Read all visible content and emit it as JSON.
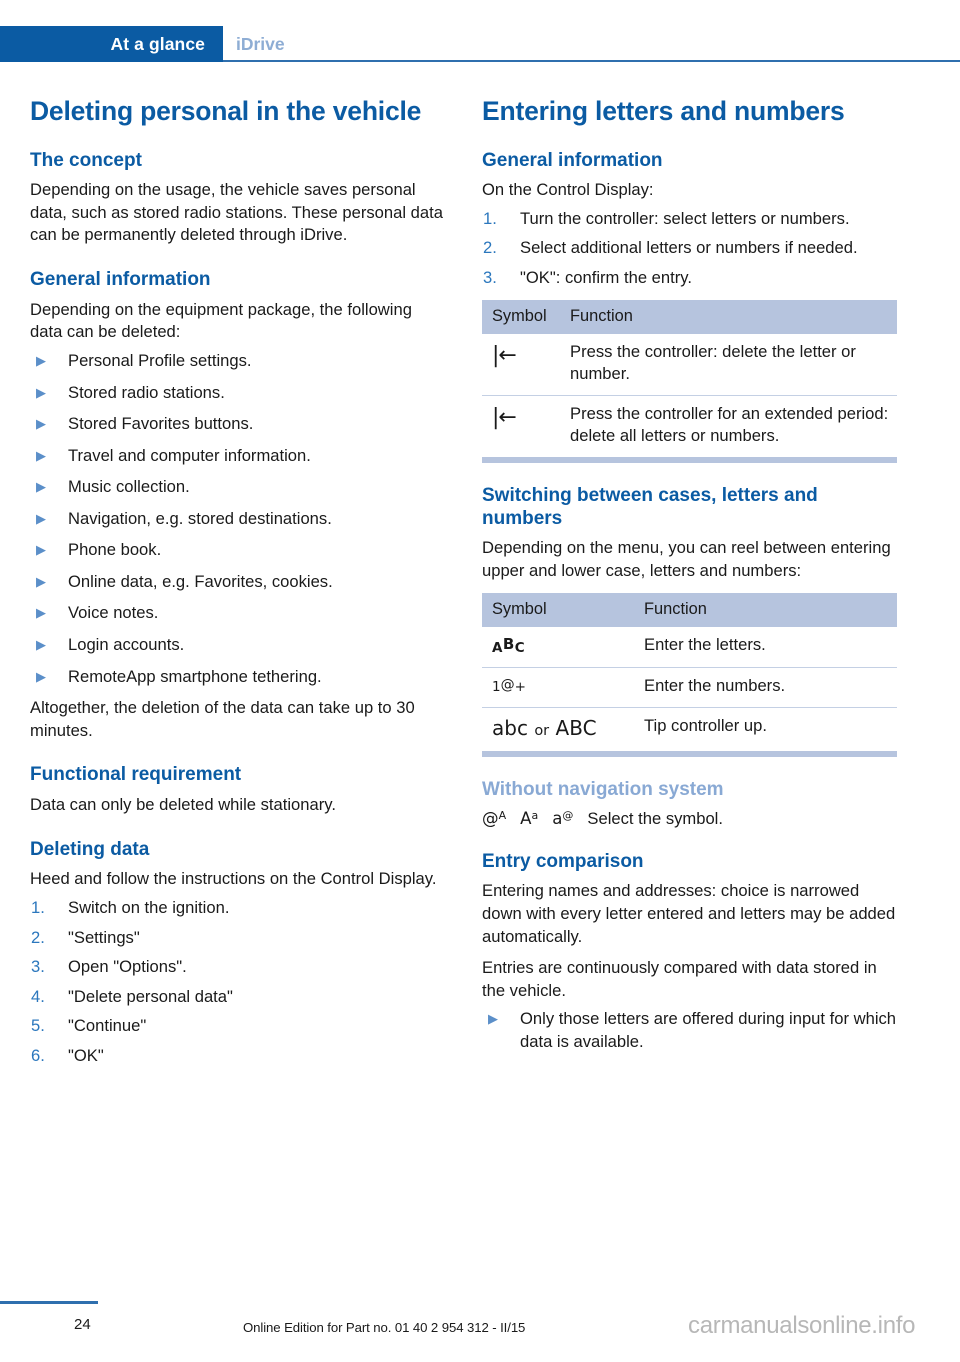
{
  "header": {
    "tab_active": "At a glance",
    "tab_inactive": "iDrive",
    "accent_color": "#0b5ba3",
    "inactive_color": "#8eadd4"
  },
  "left_column": {
    "title": "Deleting personal in the vehicle",
    "sections": [
      {
        "heading": "The concept",
        "paragraphs": [
          "Depending on the usage, the vehicle saves personal data, such as stored radio stations. These personal data can be permanently deleted through iDrive."
        ]
      },
      {
        "heading": "General information",
        "intro": "Depending on the equipment package, the following data can be deleted:",
        "bullets": [
          "Personal Profile settings.",
          "Stored radio stations.",
          "Stored Favorites buttons.",
          "Travel and computer information.",
          "Music collection.",
          "Navigation, e.g. stored destinations.",
          "Phone book.",
          "Online data, e.g. Favorites, cookies.",
          "Voice notes.",
          "Login accounts.",
          "RemoteApp smartphone tethering."
        ],
        "outro": "Altogether, the deletion of the data can take up to 30 minutes."
      },
      {
        "heading": "Functional requirement",
        "paragraphs": [
          "Data can only be deleted while stationary."
        ]
      },
      {
        "heading": "Deleting data",
        "intro": "Heed and follow the instructions on the Control Display.",
        "steps": [
          {
            "n": "1.",
            "text": "Switch on the ignition."
          },
          {
            "n": "2.",
            "text": "\"Settings\""
          },
          {
            "n": "3.",
            "text": "Open \"Options\"."
          },
          {
            "n": "4.",
            "text": "\"Delete personal data\""
          },
          {
            "n": "5.",
            "text": "\"Continue\""
          },
          {
            "n": "6.",
            "text": "\"OK\""
          }
        ]
      }
    ]
  },
  "right_column": {
    "title": "Entering letters and numbers",
    "general": {
      "heading": "General information",
      "intro": "On the Control Display:",
      "steps": [
        {
          "n": "1.",
          "text": "Turn the controller: select letters or numbers."
        },
        {
          "n": "2.",
          "text": "Select additional letters or numbers if needed."
        },
        {
          "n": "3.",
          "text": "\"OK\": confirm the entry."
        }
      ]
    },
    "table1": {
      "columns": [
        "Symbol",
        "Function"
      ],
      "rows": [
        {
          "symbol": "|←",
          "symbol_name": "backspace-icon",
          "function": "Press the controller: delete the letter or number."
        },
        {
          "symbol": "|←",
          "symbol_name": "backspace-icon",
          "function": "Press the controller for an extended period: delete all letters or numbers."
        }
      ]
    },
    "switching": {
      "heading": "Switching between cases, letters and numbers",
      "intro": "Depending on the menu, you can reel between entering upper and lower case, letters and numbers:"
    },
    "table2": {
      "columns": [
        "Symbol",
        "Function"
      ],
      "rows": [
        {
          "symbol_base": "A",
          "symbol_sup": "B",
          "symbol_tail": "C",
          "symbol_name": "abc-uppercase-icon",
          "function": "Enter the letters."
        },
        {
          "symbol_base": "1",
          "symbol_sup": "@",
          "symbol_tail": "+",
          "symbol_name": "numbers-symbols-icon",
          "function": "Enter the numbers."
        },
        {
          "symbol_lower": "abc",
          "symbol_or": "or",
          "symbol_upper": "ABC",
          "symbol_name": "case-toggle-icon",
          "function": "Tip controller up."
        }
      ]
    },
    "without_nav": {
      "heading": "Without navigation system",
      "symbols": [
        {
          "base": "@",
          "sup": "A",
          "name": "at-uppercase-icon"
        },
        {
          "base": "A",
          "sup": "a",
          "name": "uppercase-lowercase-icon"
        },
        {
          "base": "a",
          "sup": "@",
          "name": "lowercase-at-icon"
        }
      ],
      "text": "Select the symbol."
    },
    "entry_comparison": {
      "heading": "Entry comparison",
      "paragraphs": [
        "Entering names and addresses: choice is narrowed down with every letter entered and letters may be added automatically.",
        "Entries are continuously compared with data stored in the vehicle."
      ],
      "bullets": [
        "Only those letters are offered during input for which data is available."
      ]
    }
  },
  "footer": {
    "page_number": "24",
    "note": "Online Edition for Part no. 01 40 2 954 312 - II/15",
    "watermark": "carmanualsonline.info"
  }
}
